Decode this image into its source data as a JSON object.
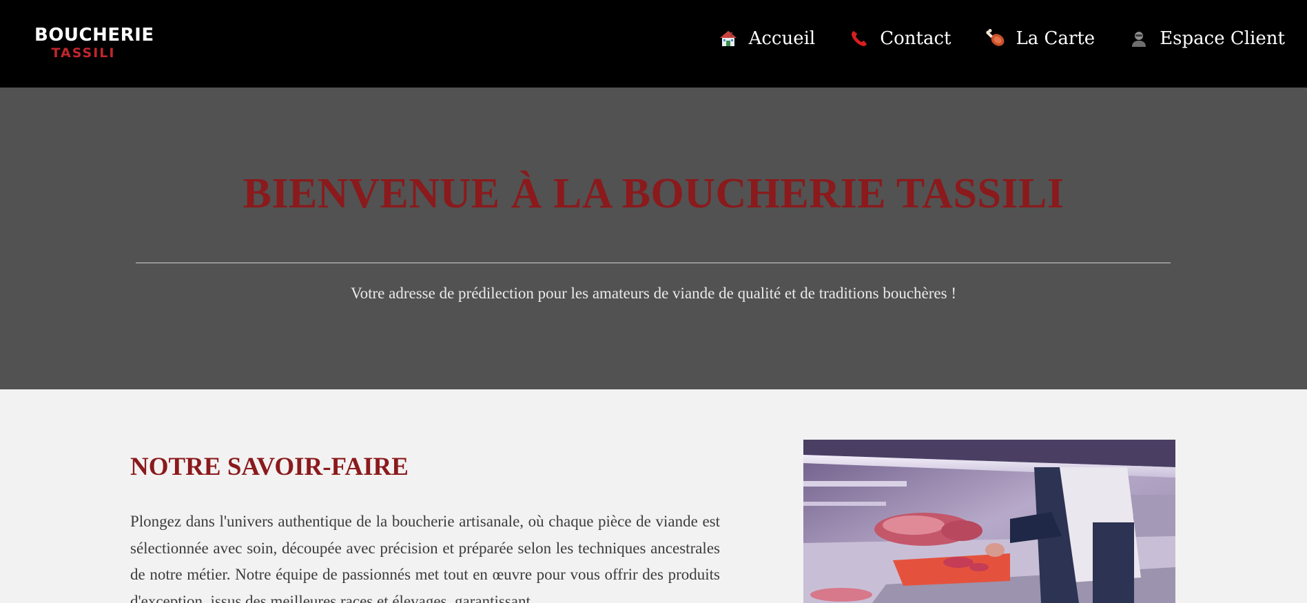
{
  "header": {
    "logo_line1": "BOUCHERIE",
    "logo_line2": "TASSILI",
    "nav": [
      {
        "label": "Accueil",
        "icon": "house-icon"
      },
      {
        "label": "Contact",
        "icon": "telephone-icon"
      },
      {
        "label": "La Carte",
        "icon": "meat-icon"
      },
      {
        "label": "Espace Client",
        "icon": "user-icon"
      }
    ]
  },
  "hero": {
    "title": "BIENVENUE À LA BOUCHERIE TASSILI",
    "subtitle": "Votre adresse de prédilection pour les amateurs de viande de qualité et de traditions bouchères !"
  },
  "section": {
    "title": "NOTRE SAVOIR-FAIRE",
    "text": "Plongez dans l'univers authentique de la boucherie artisanale, où chaque pièce de viande est sélectionnée avec soin, découpée avec précision et préparée selon les techniques ancestrales de notre métier. Notre équipe de passionnés met tout en œuvre pour vous offrir des produits d'exception, issus des meilleures races et élevages, garantissant"
  },
  "colors": {
    "header_bg": "#000000",
    "hero_bg": "#525252",
    "page_bg": "#f3f2f2",
    "accent": "#8a1a1c",
    "logo_red": "#c0272d"
  }
}
